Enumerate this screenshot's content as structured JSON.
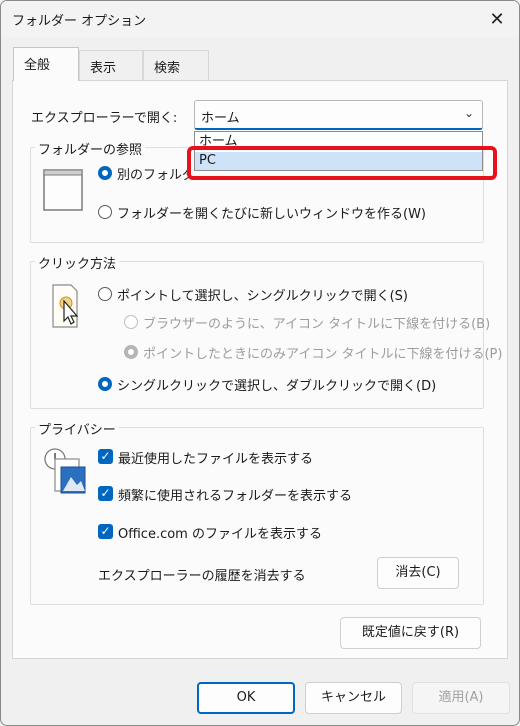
{
  "window": {
    "title": "フォルダー オプション"
  },
  "tabs": [
    {
      "label": "全般"
    },
    {
      "label": "表示"
    },
    {
      "label": "検索"
    }
  ],
  "open_explorer": {
    "label": "エクスプローラーで開く:",
    "selected": "ホーム",
    "options": [
      "ホーム",
      "PC"
    ],
    "highlighted": "PC"
  },
  "browse_folders": {
    "title": "フォルダーの参照",
    "option_same": "別のフォルダーを開くときに同じウィンドウを使う(M)",
    "option_new": "フォルダーを開くたびに新しいウィンドウを作る(W)"
  },
  "click_method": {
    "title": "クリック方法",
    "single_click": "ポイントして選択し、シングルクリックで開く(S)",
    "underline_browser": "ブラウザーのように、アイコン タイトルに下線を付ける(B)",
    "underline_hover": "ポイントしたときにのみアイコン タイトルに下線を付ける(P)",
    "double_click": "シングルクリックで選択し、ダブルクリックで開く(D)"
  },
  "privacy": {
    "title": "プライバシー",
    "recent_files": "最近使用したファイルを表示する",
    "frequent_folders": "頻繁に使用されるフォルダーを表示する",
    "office_files": "Office.com のファイルを表示する",
    "clear_label": "エクスプローラーの履歴を消去する",
    "clear_button": "消去(C)"
  },
  "restore_defaults": "既定値に戻す(R)",
  "footer": {
    "ok": "OK",
    "cancel": "キャンセル",
    "apply": "適用(A)"
  },
  "colors": {
    "accent": "#0067c0",
    "highlight_box": "#e8101a"
  }
}
